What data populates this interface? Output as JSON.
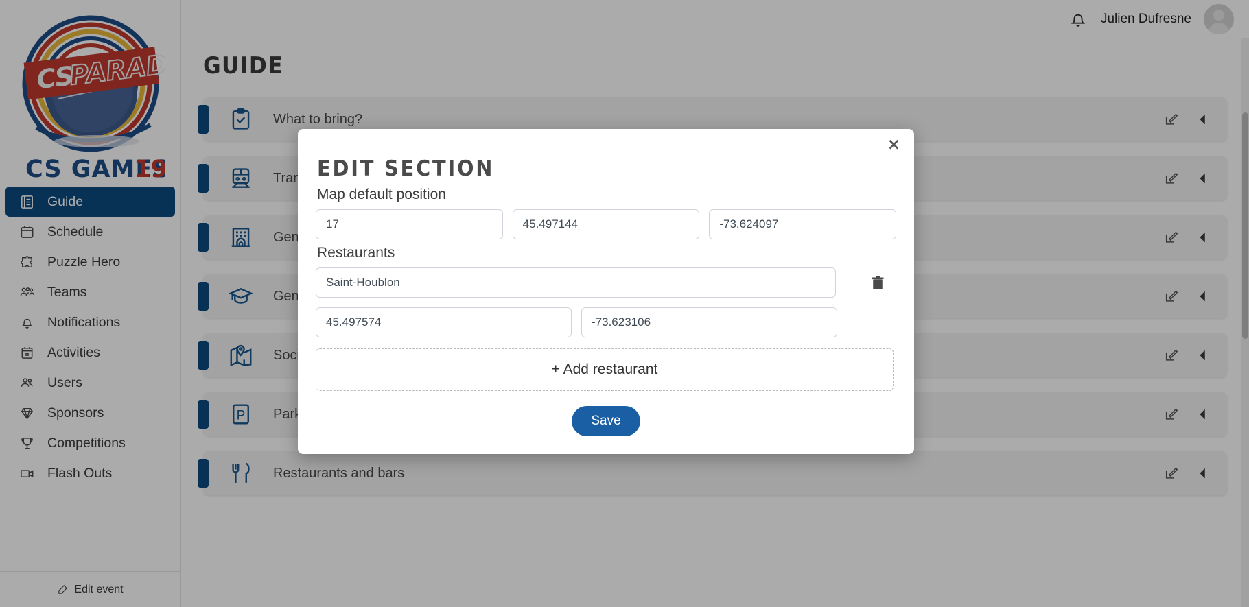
{
  "brand": {
    "logo_top_text": "CS PARADISE",
    "logo_bottom_text": "CS GAMES 19"
  },
  "topbar": {
    "bell_icon": "bell-icon",
    "username": "Julien Dufresne",
    "avatar_icon": "avatar"
  },
  "sidebar": {
    "items": [
      {
        "label": "Guide",
        "icon": "book-icon",
        "active": true
      },
      {
        "label": "Schedule",
        "icon": "calendar-icon",
        "active": false
      },
      {
        "label": "Puzzle Hero",
        "icon": "puzzle-icon",
        "active": false
      },
      {
        "label": "Teams",
        "icon": "teams-icon",
        "active": false
      },
      {
        "label": "Notifications",
        "icon": "bell-icon",
        "active": false
      },
      {
        "label": "Activities",
        "icon": "calendar-dot-icon",
        "active": false
      },
      {
        "label": "Users",
        "icon": "users-icon",
        "active": false
      },
      {
        "label": "Sponsors",
        "icon": "diamond-icon",
        "active": false
      },
      {
        "label": "Competitions",
        "icon": "trophy-icon",
        "active": false
      },
      {
        "label": "Flash Outs",
        "icon": "video-icon",
        "active": false
      }
    ],
    "footer": {
      "label": "Edit event",
      "icon": "edit-icon"
    }
  },
  "main": {
    "page_title": "GUIDE",
    "sections": [
      {
        "label": "What to bring?",
        "icon": "clipboard-check-icon"
      },
      {
        "label": "Transportation",
        "icon": "train-icon"
      },
      {
        "label": "General information",
        "icon": "building-icon"
      },
      {
        "label": "General information",
        "icon": "graduation-cap-icon"
      },
      {
        "label": "Social",
        "icon": "map-icon"
      },
      {
        "label": "Parkings",
        "icon": "parking-icon"
      },
      {
        "label": "Restaurants and bars",
        "icon": "cutlery-icon"
      }
    ],
    "row_actions": {
      "edit": "edit-icon",
      "collapse": "caret-left-icon"
    }
  },
  "modal": {
    "title": "EDIT SECTION",
    "close_label": "×",
    "map_position": {
      "label": "Map default position",
      "zoom": "17",
      "latitude": "45.497144",
      "longitude": "-73.624097"
    },
    "restaurants": {
      "label": "Restaurants",
      "items": [
        {
          "name": "Saint-Houblon",
          "latitude": "45.497574",
          "longitude": "-73.623106"
        }
      ],
      "delete_icon": "trash-icon",
      "add_label": "+ Add restaurant"
    },
    "save_label": "Save"
  },
  "colors": {
    "brand_blue": "#0d4a80",
    "accent_blue": "#1a5fa4",
    "icon_blue": "#17558c",
    "logo_red": "#c0392f",
    "logo_yellow": "#e7b83a"
  }
}
